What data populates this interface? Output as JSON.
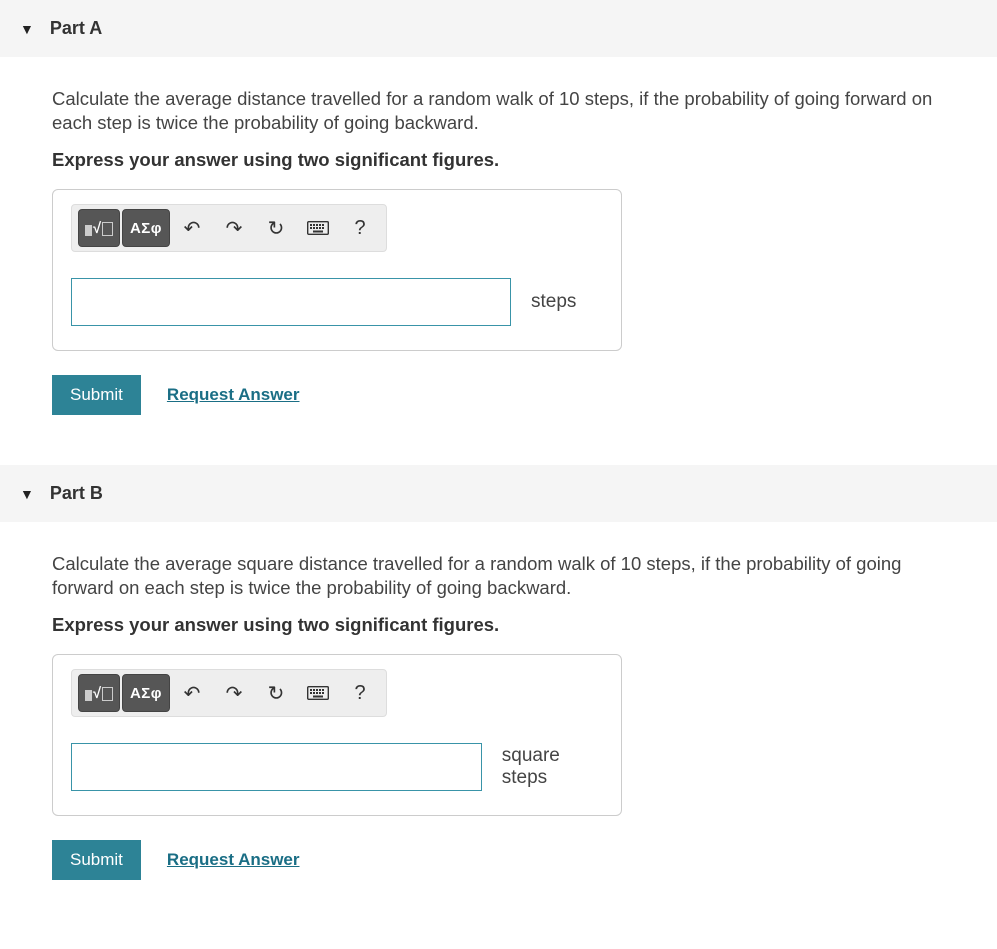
{
  "partA": {
    "title": "Part A",
    "prompt": "Calculate the average distance travelled for a random walk of 10 steps, if the probability of going forward on each step is twice the probability of going backward.",
    "instruction": "Express your answer using two significant figures.",
    "greek_label": "ΑΣφ",
    "help_label": "?",
    "unit": "steps",
    "submit": "Submit",
    "request": "Request Answer"
  },
  "partB": {
    "title": "Part B",
    "prompt": "Calculate the average square distance travelled for a random walk of 10 steps, if the probability of going forward on each step is twice the probability of going backward.",
    "instruction": "Express your answer using two significant figures.",
    "greek_label": "ΑΣφ",
    "help_label": "?",
    "unit": "square steps",
    "submit": "Submit",
    "request": "Request Answer"
  }
}
